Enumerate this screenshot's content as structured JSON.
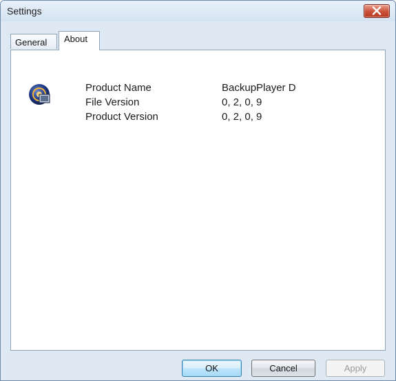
{
  "window": {
    "title": "Settings"
  },
  "tabs": [
    {
      "label": "General",
      "selected": false
    },
    {
      "label": "About",
      "selected": true
    }
  ],
  "about": {
    "icon": "app-icon",
    "rows": [
      {
        "label": "Product Name",
        "value": "BackupPlayer D"
      },
      {
        "label": "File Version",
        "value": "0, 2, 0, 9"
      },
      {
        "label": "Product Version",
        "value": "0, 2, 0, 9"
      }
    ]
  },
  "buttons": {
    "ok": "OK",
    "cancel": "Cancel",
    "apply": "Apply"
  },
  "colors": {
    "close_button": "#c9503a",
    "ok_highlight": "#3c7fb1"
  }
}
